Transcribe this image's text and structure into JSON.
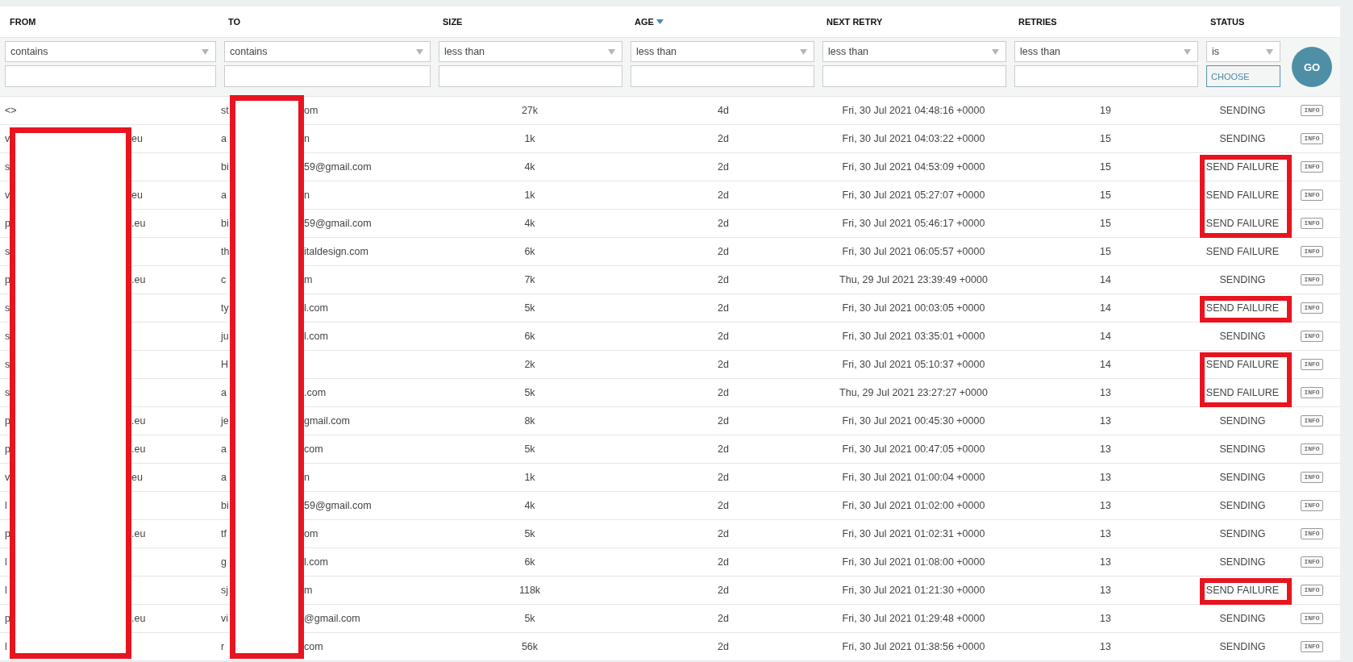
{
  "columns": [
    {
      "label": "FROM",
      "sorted": false
    },
    {
      "label": "TO",
      "sorted": false
    },
    {
      "label": "SIZE",
      "sorted": false
    },
    {
      "label": "AGE",
      "sorted": true
    },
    {
      "label": "NEXT RETRY",
      "sorted": false
    },
    {
      "label": "RETRIES",
      "sorted": false
    },
    {
      "label": "STATUS",
      "sorted": false
    }
  ],
  "filters": [
    {
      "kind": "text",
      "operator": "contains"
    },
    {
      "kind": "text",
      "operator": "contains"
    },
    {
      "kind": "text",
      "operator": "less than"
    },
    {
      "kind": "text",
      "operator": "less than"
    },
    {
      "kind": "text",
      "operator": "less than"
    },
    {
      "kind": "text",
      "operator": "less than"
    },
    {
      "kind": "choice",
      "operator": "is",
      "button": "CHOOSE"
    }
  ],
  "go_button": "GO",
  "rows": [
    {
      "from": [
        "<>"
      ],
      "to": [
        "st",
        "om"
      ],
      "size": "27k",
      "age": "4d",
      "next_retry": "Fri, 30 Jul 2021 04:48:16 +0000",
      "retries": "19",
      "status": "SENDING",
      "action": "INFO",
      "from_redacted": false,
      "to_redacted": true,
      "status_highlighted": false
    },
    {
      "from": [
        "v",
        "eu"
      ],
      "to": [
        "a",
        "n"
      ],
      "size": "1k",
      "age": "2d",
      "next_retry": "Fri, 30 Jul 2021 04:03:22 +0000",
      "retries": "15",
      "status": "SENDING",
      "action": "INFO",
      "from_redacted": true,
      "to_redacted": true,
      "status_highlighted": false
    },
    {
      "from": [
        "s"
      ],
      "to": [
        "bi",
        "59@gmail.com"
      ],
      "size": "4k",
      "age": "2d",
      "next_retry": "Fri, 30 Jul 2021 04:53:09 +0000",
      "retries": "15",
      "status": "SEND FAILURE",
      "action": "INFO",
      "from_redacted": true,
      "to_redacted": true,
      "status_highlighted": true
    },
    {
      "from": [
        "v",
        "eu"
      ],
      "to": [
        "a",
        "n"
      ],
      "size": "1k",
      "age": "2d",
      "next_retry": "Fri, 30 Jul 2021 05:27:07 +0000",
      "retries": "15",
      "status": "SEND FAILURE",
      "action": "INFO",
      "from_redacted": true,
      "to_redacted": true,
      "status_highlighted": true
    },
    {
      "from": [
        "p",
        ".eu"
      ],
      "to": [
        "bi",
        "59@gmail.com"
      ],
      "size": "4k",
      "age": "2d",
      "next_retry": "Fri, 30 Jul 2021 05:46:17 +0000",
      "retries": "15",
      "status": "SEND FAILURE",
      "action": "INFO",
      "from_redacted": true,
      "to_redacted": true,
      "status_highlighted": true
    },
    {
      "from": [
        "s"
      ],
      "to": [
        "th",
        "italdesign.com"
      ],
      "size": "6k",
      "age": "2d",
      "next_retry": "Fri, 30 Jul 2021 06:05:57 +0000",
      "retries": "15",
      "status": "SEND FAILURE",
      "action": "INFO",
      "from_redacted": true,
      "to_redacted": true,
      "status_highlighted": false
    },
    {
      "from": [
        "p",
        ".eu"
      ],
      "to": [
        "c",
        "m"
      ],
      "size": "7k",
      "age": "2d",
      "next_retry": "Thu, 29 Jul 2021 23:39:49 +0000",
      "retries": "14",
      "status": "SENDING",
      "action": "INFO",
      "from_redacted": true,
      "to_redacted": true,
      "status_highlighted": false
    },
    {
      "from": [
        "s"
      ],
      "to": [
        "ty",
        "l.com"
      ],
      "size": "5k",
      "age": "2d",
      "next_retry": "Fri, 30 Jul 2021 00:03:05 +0000",
      "retries": "14",
      "status": "SEND FAILURE",
      "action": "INFO",
      "from_redacted": true,
      "to_redacted": true,
      "status_highlighted": true
    },
    {
      "from": [
        "s"
      ],
      "to": [
        "ju",
        "l.com"
      ],
      "size": "6k",
      "age": "2d",
      "next_retry": "Fri, 30 Jul 2021 03:35:01 +0000",
      "retries": "14",
      "status": "SENDING",
      "action": "INFO",
      "from_redacted": true,
      "to_redacted": true,
      "status_highlighted": false
    },
    {
      "from": [
        "s"
      ],
      "to": [
        "H"
      ],
      "size": "2k",
      "age": "2d",
      "next_retry": "Fri, 30 Jul 2021 05:10:37 +0000",
      "retries": "14",
      "status": "SEND FAILURE",
      "action": "INFO",
      "from_redacted": true,
      "to_redacted": true,
      "status_highlighted": true
    },
    {
      "from": [
        "s"
      ],
      "to": [
        "a",
        ".com"
      ],
      "size": "5k",
      "age": "2d",
      "next_retry": "Thu, 29 Jul 2021 23:27:27 +0000",
      "retries": "13",
      "status": "SEND FAILURE",
      "action": "INFO",
      "from_redacted": true,
      "to_redacted": true,
      "status_highlighted": true
    },
    {
      "from": [
        "p",
        ".eu"
      ],
      "to": [
        "je",
        "gmail.com"
      ],
      "size": "8k",
      "age": "2d",
      "next_retry": "Fri, 30 Jul 2021 00:45:30 +0000",
      "retries": "13",
      "status": "SENDING",
      "action": "INFO",
      "from_redacted": true,
      "to_redacted": true,
      "status_highlighted": false
    },
    {
      "from": [
        "p",
        ".eu"
      ],
      "to": [
        "a",
        "com"
      ],
      "size": "5k",
      "age": "2d",
      "next_retry": "Fri, 30 Jul 2021 00:47:05 +0000",
      "retries": "13",
      "status": "SENDING",
      "action": "INFO",
      "from_redacted": true,
      "to_redacted": true,
      "status_highlighted": false
    },
    {
      "from": [
        "v",
        "eu"
      ],
      "to": [
        "a",
        "n"
      ],
      "size": "1k",
      "age": "2d",
      "next_retry": "Fri, 30 Jul 2021 01:00:04 +0000",
      "retries": "13",
      "status": "SENDING",
      "action": "INFO",
      "from_redacted": true,
      "to_redacted": true,
      "status_highlighted": false
    },
    {
      "from": [
        "l"
      ],
      "to": [
        "bi",
        "59@gmail.com"
      ],
      "size": "4k",
      "age": "2d",
      "next_retry": "Fri, 30 Jul 2021 01:02:00 +0000",
      "retries": "13",
      "status": "SENDING",
      "action": "INFO",
      "from_redacted": true,
      "to_redacted": true,
      "status_highlighted": false
    },
    {
      "from": [
        "p",
        ".eu"
      ],
      "to": [
        "tf",
        "om"
      ],
      "size": "5k",
      "age": "2d",
      "next_retry": "Fri, 30 Jul 2021 01:02:31 +0000",
      "retries": "13",
      "status": "SENDING",
      "action": "INFO",
      "from_redacted": true,
      "to_redacted": true,
      "status_highlighted": false
    },
    {
      "from": [
        "l"
      ],
      "to": [
        "g",
        "l.com"
      ],
      "size": "6k",
      "age": "2d",
      "next_retry": "Fri, 30 Jul 2021 01:08:00 +0000",
      "retries": "13",
      "status": "SENDING",
      "action": "INFO",
      "from_redacted": true,
      "to_redacted": true,
      "status_highlighted": false
    },
    {
      "from": [
        "l"
      ],
      "to": [
        "sj",
        "m"
      ],
      "size": "118k",
      "age": "2d",
      "next_retry": "Fri, 30 Jul 2021 01:21:30 +0000",
      "retries": "13",
      "status": "SEND FAILURE",
      "action": "INFO",
      "from_redacted": true,
      "to_redacted": true,
      "status_highlighted": true
    },
    {
      "from": [
        "p",
        ".eu"
      ],
      "to": [
        "vi",
        "@gmail.com"
      ],
      "size": "5k",
      "age": "2d",
      "next_retry": "Fri, 30 Jul 2021 01:29:48 +0000",
      "retries": "13",
      "status": "SENDING",
      "action": "INFO",
      "from_redacted": true,
      "to_redacted": true,
      "status_highlighted": false
    },
    {
      "from": [
        "l"
      ],
      "to": [
        "r",
        "com"
      ],
      "size": "56k",
      "age": "2d",
      "next_retry": "Fri, 30 Jul 2021 01:38:56 +0000",
      "retries": "13",
      "status": "SENDING",
      "action": "INFO",
      "from_redacted": true,
      "to_redacted": true,
      "status_highlighted": false
    }
  ]
}
